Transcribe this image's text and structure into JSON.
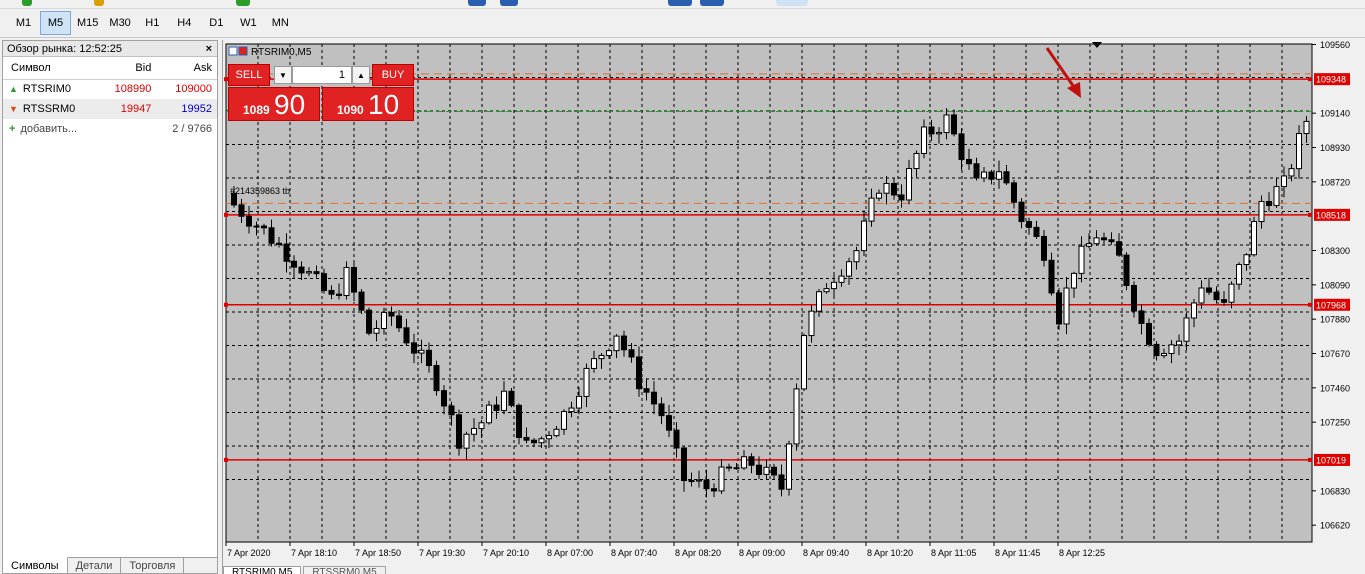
{
  "timeframes": [
    "M1",
    "M5",
    "M15",
    "M30",
    "H1",
    "H4",
    "D1",
    "W1",
    "MN"
  ],
  "active_timeframe": "M5",
  "market_watch": {
    "title": "Обзор рынка: 12:52:25",
    "headers": {
      "symbol": "Символ",
      "bid": "Bid",
      "ask": "Ask"
    },
    "rows": [
      {
        "symbol": "RTSRIM0",
        "bid": "108990",
        "ask": "109000",
        "direction": "up"
      },
      {
        "symbol": "RTSSRM0",
        "bid": "19947",
        "ask": "19952",
        "direction": "down"
      }
    ],
    "add_label": "добавить...",
    "count": "2 / 9766",
    "tabs": [
      "Символы",
      "Детали",
      "Торговля"
    ],
    "active_tab": "Символы"
  },
  "chart": {
    "title": "RTSRIM0,M5",
    "annotation": "#214359863 tb",
    "y_ticks": [
      "109560",
      "109140",
      "108930",
      "108720",
      "108300",
      "108090",
      "107880",
      "107670",
      "107460",
      "107250",
      "106830",
      "106620"
    ],
    "price_labels": [
      "109348",
      "108518",
      "107968",
      "107019"
    ],
    "x_ticks": [
      "7 Apr 2020",
      "7 Apr 18:10",
      "7 Apr 18:50",
      "7 Apr 19:30",
      "7 Apr 20:10",
      "8 Apr 07:00",
      "8 Apr 07:40",
      "8 Apr 08:20",
      "8 Apr 09:00",
      "8 Apr 09:40",
      "8 Apr 10:20",
      "8 Apr 11:05",
      "8 Apr 11:45",
      "8 Apr 12:25"
    ],
    "tabs": [
      "RTSRIM0,M5",
      "RTSSRM0,M5"
    ],
    "colors": {
      "background": "#c0c0c0",
      "level_line": "#e00000",
      "bid_line": "#22a022",
      "bull": "#ffffff",
      "bear": "#000000",
      "arrow": "#c01010"
    }
  },
  "trade_panel": {
    "sell_label": "SELL",
    "buy_label": "BUY",
    "volume": "1",
    "sell_price_small": "1089",
    "sell_price_big": "90",
    "buy_price_small": "1090",
    "buy_price_big": "10"
  }
}
